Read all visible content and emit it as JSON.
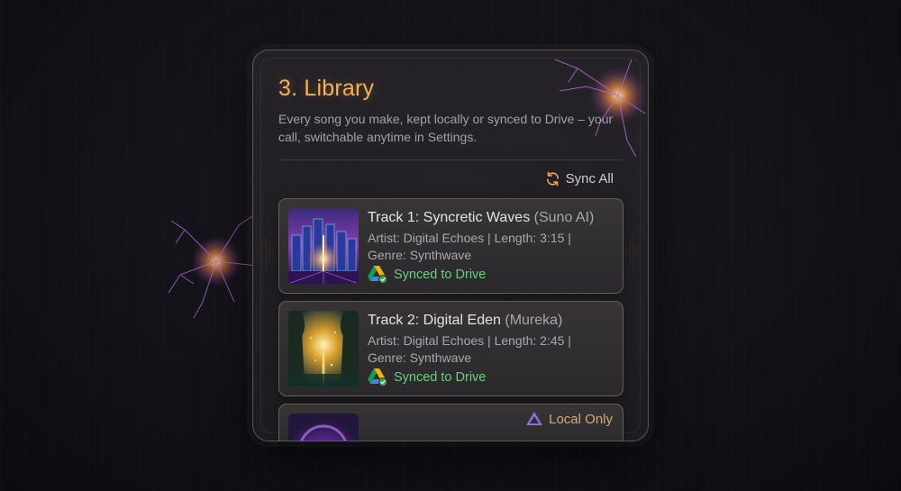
{
  "library": {
    "title": "3. Library",
    "subtitle": "Every song you make, kept locally or synced to Drive – your call, switchable anytime in Settings.",
    "sync_all_label": "Sync All"
  },
  "tracks": [
    {
      "title": "Track 1: Syncretic Waves",
      "source": "(Suno AI)",
      "meta": "Artist: Digital Echoes | Length: 3:15 | Genre: Synthwave",
      "status": "Synced to Drive",
      "status_icon": "google-drive-icon",
      "art": "neon-city-artwork"
    },
    {
      "title": "Track 2: Digital Eden",
      "source": "(Mureka)",
      "meta": "Artist: Digital Echoes | Length: 2:45 | Genre: Synthwave",
      "status": "Synced to Drive",
      "status_icon": "google-drive-icon",
      "art": "glowing-forest-artwork"
    },
    {
      "status": "Local Only",
      "status_icon": "local-drive-icon",
      "art": "purple-orb-artwork"
    }
  ],
  "colors": {
    "accent_orange": "#f3b25a",
    "synced_green": "#66d27a",
    "local_amber": "#d5aa72",
    "background": "#121218"
  }
}
